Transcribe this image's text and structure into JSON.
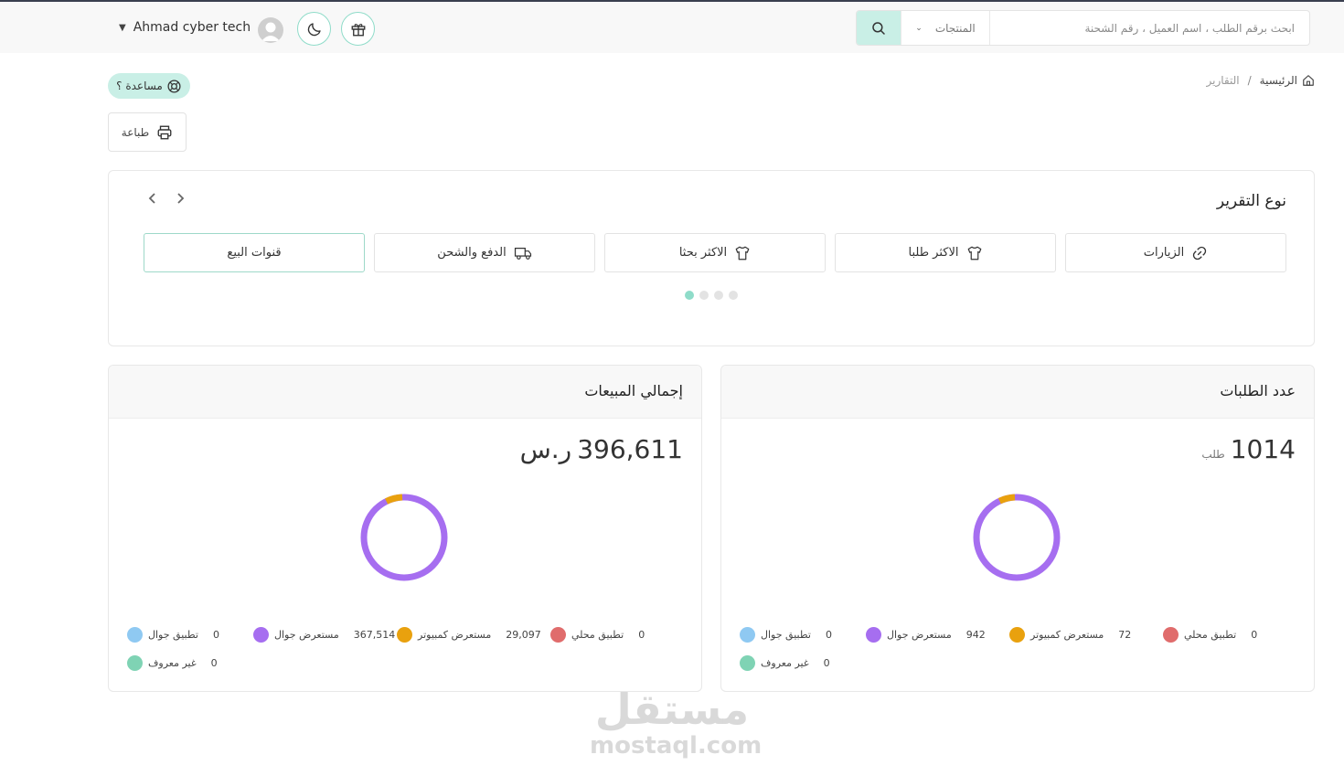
{
  "header": {
    "search_placeholder": "ابحث برقم الطلب ، اسم العميل ، رقم الشحنة",
    "search_scope": "المنتجات",
    "user_name": "Ahmad cyber tech"
  },
  "breadcrumb": {
    "home": "الرئيسية",
    "separator": "/",
    "current": "التقارير"
  },
  "actions": {
    "help": "مساعدة ؟",
    "print": "طباعة"
  },
  "report_type": {
    "title": "نوع التقرير",
    "tabs": [
      {
        "label": "الزيارات",
        "icon": "link-icon"
      },
      {
        "label": "الاكثر طلبا",
        "icon": "shirt-icon"
      },
      {
        "label": "الاكثر بحثا",
        "icon": "shirt-icon"
      },
      {
        "label": "الدفع والشحن",
        "icon": "truck-icon"
      },
      {
        "label": "قنوات البيع",
        "icon": "",
        "active": true
      }
    ],
    "page_dots": 4,
    "active_dot": 0
  },
  "orders_card": {
    "title": "عدد الطلبات",
    "value": "1014",
    "unit": "طلب",
    "legend": [
      {
        "label": "تطبيق محلي",
        "value": "0",
        "color": "#e06c6c"
      },
      {
        "label": "مستعرض كمبيوتر",
        "value": "72",
        "color": "#e9a10e"
      },
      {
        "label": "مستعرض جوال",
        "value": "942",
        "color": "#a66ef0"
      },
      {
        "label": "تطبيق جوال",
        "value": "0",
        "color": "#8fc9f2"
      },
      {
        "label": "غير معروف",
        "value": "0",
        "color": "#7fd3b4"
      }
    ]
  },
  "sales_card": {
    "title": "إجمالي المبيعات",
    "value": "396,611",
    "unit": "ر.س",
    "legend": [
      {
        "label": "تطبيق محلي",
        "value": "0",
        "color": "#e06c6c"
      },
      {
        "label": "مستعرض كمبيوتر",
        "value": "29,097",
        "color": "#e9a10e"
      },
      {
        "label": "مستعرض جوال",
        "value": "367,514",
        "color": "#a66ef0"
      },
      {
        "label": "تطبيق جوال",
        "value": "0",
        "color": "#8fc9f2"
      },
      {
        "label": "غير معروف",
        "value": "0",
        "color": "#7fd3b4"
      }
    ]
  },
  "watermark": {
    "arabic": "مستقل",
    "latin": "mostaql.com"
  }
}
